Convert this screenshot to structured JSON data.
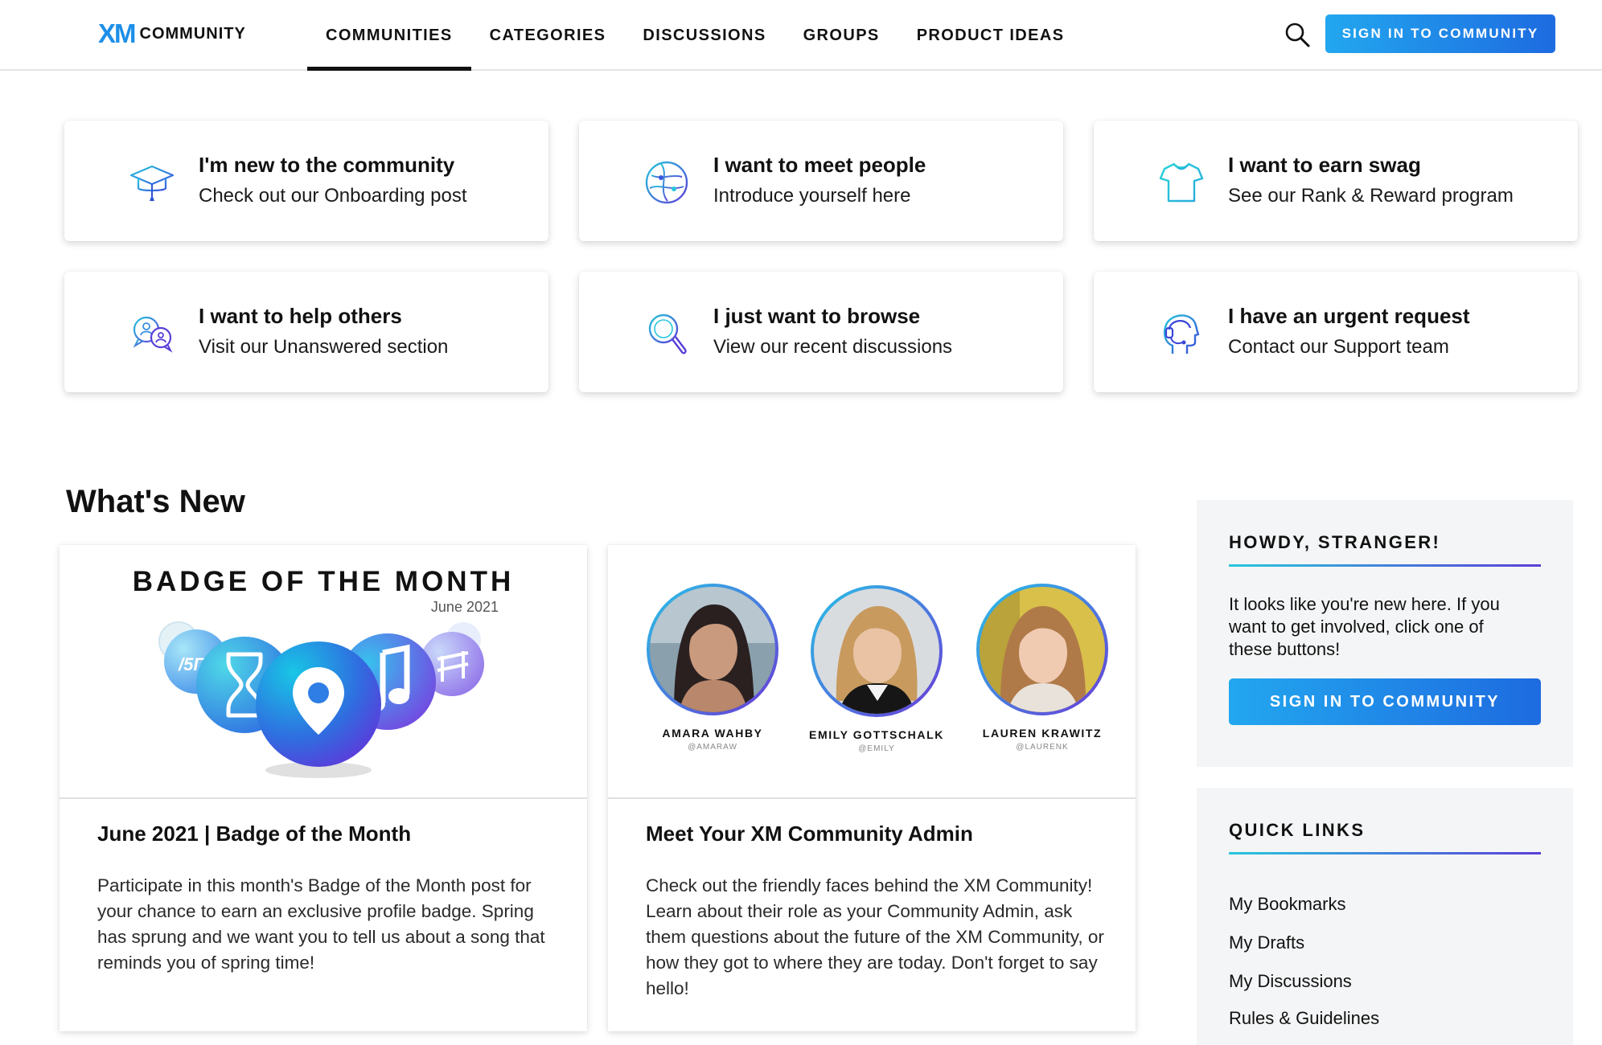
{
  "header": {
    "logo_mark": "XM",
    "logo_word": "COMMUNITY",
    "nav": [
      "COMMUNITIES",
      "CATEGORIES",
      "DISCUSSIONS",
      "GROUPS",
      "PRODUCT IDEAS"
    ],
    "active_nav": "COMMUNITIES",
    "cta_label": "SIGN IN TO COMMUNITY"
  },
  "tiles": [
    {
      "title": "I'm new to the community",
      "subtitle": "Check out our Onboarding post",
      "icon": "graduation-cap-icon"
    },
    {
      "title": "I want to meet people",
      "subtitle": "Introduce yourself here",
      "icon": "globe-network-icon"
    },
    {
      "title": "I want to earn swag",
      "subtitle": "See our Rank & Reward program",
      "icon": "t-shirt-icon"
    },
    {
      "title": "I want to help others",
      "subtitle": "Visit our Unanswered section",
      "icon": "chat-bubbles-icon"
    },
    {
      "title": "I just want to browse",
      "subtitle": "View our recent discussions",
      "icon": "magnifier-icon"
    },
    {
      "title": "I have an urgent request",
      "subtitle": "Contact our Support team",
      "icon": "headset-icon"
    }
  ],
  "whats_new": {
    "heading": "What's New",
    "posts": [
      {
        "banner_title": "BADGE OF THE MONTH",
        "banner_date": "June 2021",
        "title": "June 2021 | Badge of the Month",
        "body": "Participate in this month's Badge of the Month post for your chance to earn an exclusive profile badge. Spring has sprung and we want you to tell us about a song that reminds you of spring time!"
      },
      {
        "admins": [
          {
            "name": "AMARA WAHBY",
            "handle": "@AMARAW"
          },
          {
            "name": "EMILY GOTTSCHALK",
            "handle": "@EMILY"
          },
          {
            "name": "LAUREN KRAWITZ",
            "handle": "@LAURENK"
          }
        ],
        "title": "Meet Your XM Community Admin",
        "body": "Check out the friendly faces behind the XM Community! Learn about their role as your Community Admin, ask them questions about the future of the XM Community, or how they got to where they are today. Don't forget to say hello!"
      }
    ]
  },
  "sidebar": {
    "howdy": {
      "heading": "HOWDY, STRANGER!",
      "text": "It looks like you're new here. If you want to get involved, click one of these buttons!",
      "cta_label": "SIGN IN TO COMMUNITY"
    },
    "quick_links": {
      "heading": "QUICK LINKS",
      "links": [
        "My Bookmarks",
        "My Drafts",
        "My Discussions",
        "Rules & Guidelines"
      ]
    }
  },
  "colors": {
    "brand_blue": "#1e8ee8",
    "cta_gradient_start": "#22a7ef",
    "cta_gradient_end": "#1e6be0",
    "accent_teal": "#27c6dd",
    "accent_purple": "#5a3fd8"
  }
}
